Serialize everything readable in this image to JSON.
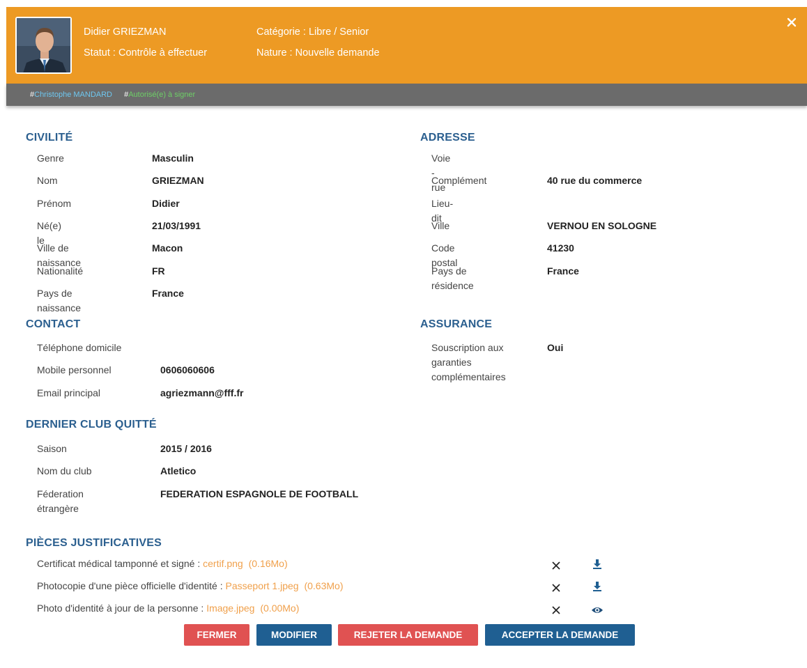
{
  "header": {
    "name": "Didier GRIEZMAN",
    "statut": "Statut : Contrôle à effectuer",
    "categorie": "Catégorie : Libre / Senior",
    "nature": "Nature : Nouvelle demande",
    "close_icon": "close-icon",
    "color": "#ed9a24"
  },
  "tags": [
    {
      "hash": "#",
      "text": "Christophe MANDARD",
      "color": "#6ec7f0"
    },
    {
      "hash": "#",
      "text": "Autorisé(e) à signer",
      "color": "#6ecf67"
    }
  ],
  "civilite": {
    "title": "CIVILITÉ",
    "rows": [
      {
        "label": "Genre",
        "value": "Masculin"
      },
      {
        "label": "Nom",
        "value": "GRIEZMAN"
      },
      {
        "label": "Prénom",
        "value": "Didier"
      },
      {
        "label": "Né(e) le",
        "value": "21/03/1991"
      },
      {
        "label": "Ville de naissance",
        "value": "Macon"
      },
      {
        "label": "Nationalité",
        "value": "FR"
      },
      {
        "label": "Pays de naissance",
        "value": "France"
      }
    ]
  },
  "adresse": {
    "title": "ADRESSE",
    "rows": [
      {
        "label": "Voie - rue",
        "value": ""
      },
      {
        "label": "Complément",
        "value": "40 rue du commerce"
      },
      {
        "label": "Lieu-dit",
        "value": ""
      },
      {
        "label": "Ville",
        "value": "VERNOU EN SOLOGNE"
      },
      {
        "label": "Code postal",
        "value": "41230"
      },
      {
        "label": "Pays de résidence",
        "value": "France"
      }
    ]
  },
  "contact": {
    "title": "CONTACT",
    "rows": [
      {
        "label": "Téléphone domicile",
        "value": ""
      },
      {
        "label": "Mobile personnel",
        "value": "0606060606"
      },
      {
        "label": "Email principal",
        "value": "agriezmann@fff.fr"
      }
    ]
  },
  "assurance": {
    "title": "ASSURANCE",
    "label_l1": "Souscription aux",
    "label_l2": "garanties",
    "label_l3": "complémentaires",
    "value": "Oui"
  },
  "dernier_club": {
    "title": "DERNIER CLUB QUITTÉ",
    "saison_label": "Saison",
    "saison_value": "2015 / 2016",
    "club_label": "Nom du club",
    "club_value": "Atletico",
    "fed_label_l1": "Féderation",
    "fed_label_l2": "étrangère",
    "fed_value": "FEDERATION ESPAGNOLE DE FOOTBALL"
  },
  "pieces": {
    "title": "PIÈCES JUSTIFICATIVES",
    "items": [
      {
        "label": "Certificat médical tamponné et signé :",
        "file": "certif.png",
        "size": "(0.16Mo)",
        "action_icon": "download-icon"
      },
      {
        "label": "Photocopie d'une pièce officielle d'identité :",
        "file": "Passeport 1.jpeg",
        "size": "(0.63Mo)",
        "action_icon": "download-icon"
      },
      {
        "label": "Photo d'identité à jour de la personne :",
        "file": "Image.jpeg",
        "size": "(0.00Mo)",
        "action_icon": "eye-icon"
      }
    ]
  },
  "buttons": {
    "fermer": "FERMER",
    "modifier": "MODIFIER",
    "rejeter": "REJETER LA DEMANDE",
    "accepter": "ACCEPTER LA DEMANDE",
    "red": "#e05252",
    "blue": "#1f5f92"
  }
}
